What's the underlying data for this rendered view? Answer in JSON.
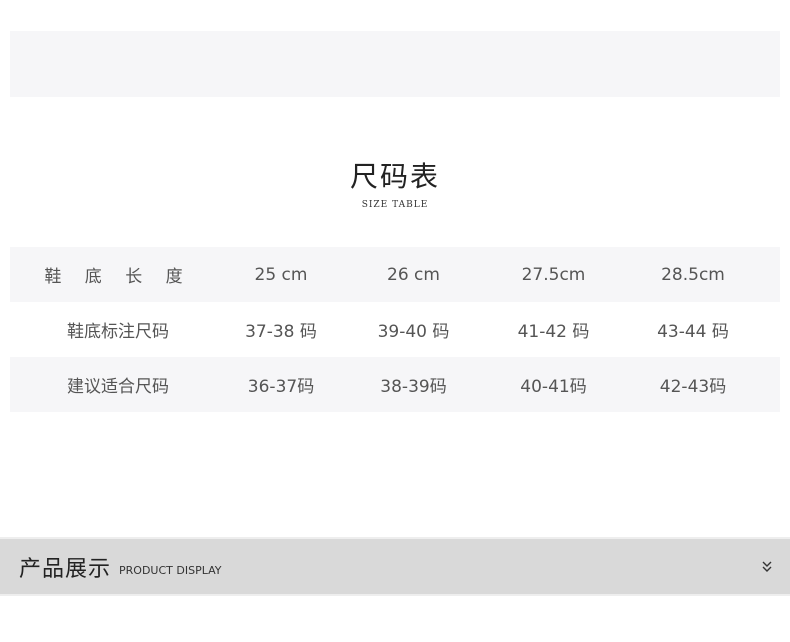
{
  "size_section": {
    "title": "尺码表",
    "subtitle": "SIZE TABLE",
    "rows": [
      [
        "鞋 底 长 度",
        "25 cm",
        "26 cm",
        "27.5cm",
        "28.5cm"
      ],
      [
        "鞋底标注尺码",
        "37-38 码",
        "39-40 码",
        "41-42 码",
        "43-44 码"
      ],
      [
        "建议适合尺码",
        "36-37码",
        "38-39码",
        "40-41码",
        "42-43码"
      ]
    ]
  },
  "product_section": {
    "title": "产品展示",
    "subtitle": "PRODUCT DISPLAY",
    "icon": "double-chevron-down-icon"
  },
  "colors": {
    "stripe": "#f6f6f8",
    "bar": "#d9d9d9",
    "text": "#555555"
  }
}
